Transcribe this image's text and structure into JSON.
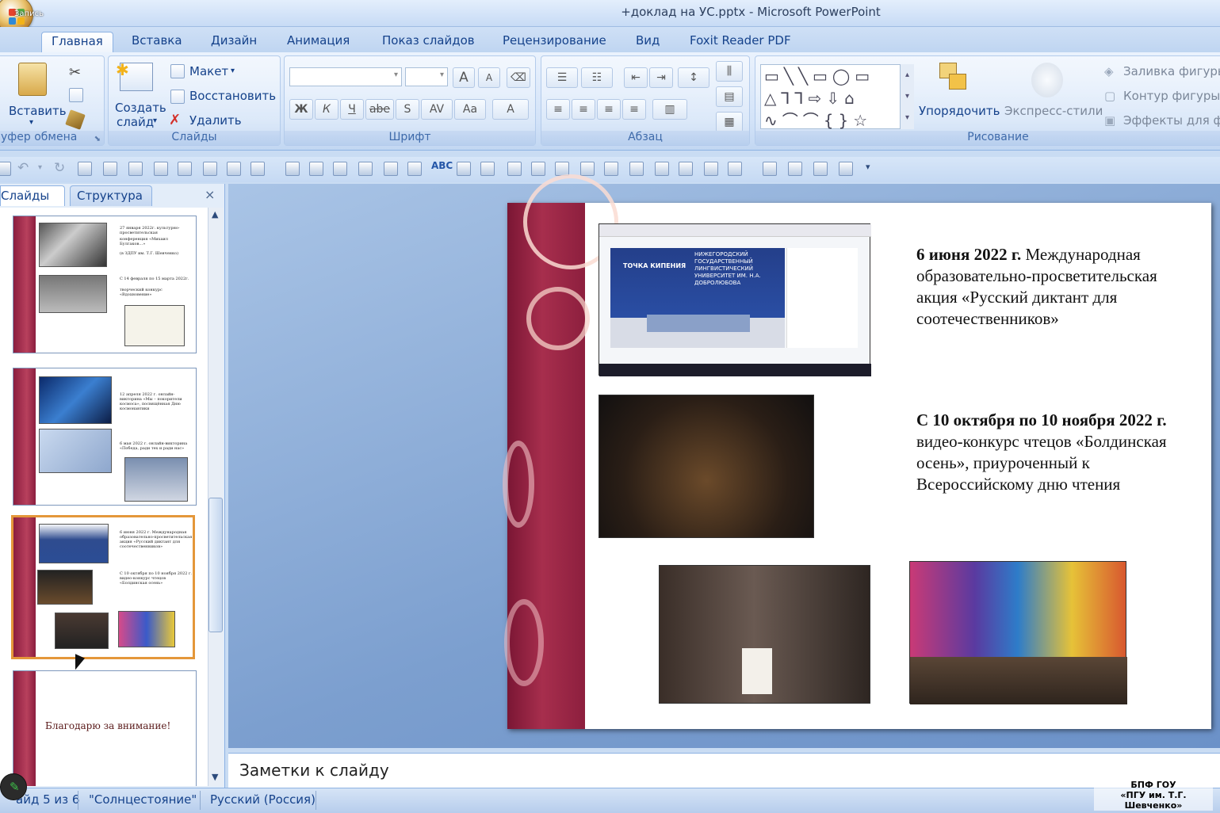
{
  "window": {
    "title": "+доклад на УС.pptx - Microsoft PowerPoint",
    "recording_label": "Запись"
  },
  "tabs": [
    "Главная",
    "Вставка",
    "Дизайн",
    "Анимация",
    "Показ слайдов",
    "Рецензирование",
    "Вид",
    "Foxit Reader PDF"
  ],
  "active_tab": "Главная",
  "ribbon": {
    "clipboard": {
      "paste_label": "Вставить",
      "group_label": "уфер обмена"
    },
    "slides": {
      "new_slide_line1": "Создать",
      "new_slide_line2": "слайд",
      "layout": "Макет",
      "reset": "Восстановить",
      "delete": "Удалить",
      "group_label": "Слайды"
    },
    "font": {
      "group_label": "Шрифт",
      "bold": "Ж",
      "italic": "К",
      "underline": "Ч",
      "strike": "abe",
      "shadow": "S",
      "spacing": "AV",
      "case": "Aa",
      "color": "A",
      "grow": "A",
      "shrink": "A"
    },
    "paragraph": {
      "group_label": "Абзац"
    },
    "drawing": {
      "arrange": "Упорядочить",
      "quick_styles": "Экспресс-стили",
      "fill": "Заливка фигуры",
      "outline": "Контур фигуры",
      "effects": "Эффекты для фи",
      "group_label": "Рисование"
    }
  },
  "left_panel": {
    "tab_slides": "Слайды",
    "tab_outline": "Структура",
    "close": "×"
  },
  "thumbnails": [
    {
      "num": "",
      "texts": [
        "27 января 2022г. культурно-просветительская",
        "конференция «Михаил Булгаков…»",
        "(в ЗДПУ им. Т.Г. Шевченко)",
        "С 14 февраля по 15 марта 2022г.",
        "творческий конкурс «Вдохновение»"
      ]
    },
    {
      "num": "",
      "texts": [
        "12 апреля 2022 г. онлайн-викторина «Мы – покорители космоса», посвящённая Дню космонавтики",
        "6 мая 2022 г. онлайн-викторина «Победа, ради тех и ради нас»"
      ]
    },
    {
      "num": "",
      "texts": [
        "6 июня 2022 г. Международная образовательно-просветительская акция «Русский диктант для соотечественников»",
        "С 10 октября по 10 ноября 2022 г. видео-конкурс чтецов «Болдинская осень»"
      ]
    },
    {
      "num": "",
      "texts": [
        "Благодарю за внимание!"
      ]
    }
  ],
  "slide": {
    "block1_bold": "6 июня 2022 г.",
    "block1_rest": " Международная образовательно-просветительская акция «Русский диктант для соотечественников»",
    "block2_bold": "С 10 октября по 10 ноября 2022 г.",
    "block2_rest": " видео-конкурс чтецов «Болдинская осень», приуроченный к Всероссийскому дню чтения",
    "screenshot_banner": "НИЖЕГОРОДСКИЙ ГОСУДАРСТВЕННЫЙ ЛИНГВИСТИЧЕСКИЙ УНИВЕРСИТЕТ ИМ. Н.А. ДОБРОЛЮБОВА",
    "screenshot_logo": "ТОЧКА КИПЕНИЯ"
  },
  "notes": {
    "placeholder": "Заметки к слайду"
  },
  "status": {
    "slide": "айд 5 из 6",
    "theme": "\"Солнцестояние\"",
    "language": "Русский (Россия)"
  },
  "watermark": {
    "line1": "БПФ ГОУ",
    "line2": "«ПГУ им. Т.Г. Шевченко»"
  }
}
